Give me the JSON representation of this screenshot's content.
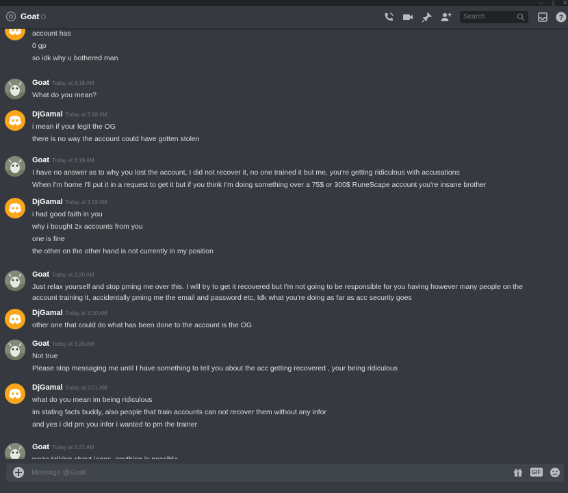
{
  "header": {
    "channel_name": "Goat",
    "search_placeholder": "Search"
  },
  "messages": [
    {
      "author": "DjGamal",
      "avatar": "discord-avatar",
      "time": "",
      "lines": [
        "account has",
        "0 gp",
        "so idk why u bothered man"
      ]
    },
    {
      "author": "Goat",
      "avatar": "goat-avatar",
      "time": "Today at 3:18 AM",
      "lines": [
        "What do you mean?"
      ]
    },
    {
      "author": "DjGamal",
      "avatar": "discord-avatar",
      "time": "Today at 3:18 AM",
      "lines": [
        "i mean if your legit the OG",
        "there is no way the account could have gotten stolen"
      ]
    },
    {
      "author": "Goat",
      "avatar": "goat-avatar",
      "time": "Today at 3:19 AM",
      "lines": [
        "I have no answer as to why you lost the account, I did not recover it, no one trained it but me, you're getting ridiculous with accusations",
        "When I'm home I'll put it in a request to get it but if you think I'm doing something over a 75$ or 300$ RuneScape account you're insane brother"
      ]
    },
    {
      "author": "DjGamal",
      "avatar": "discord-avatar",
      "time": "Today at 3:19 AM",
      "lines": [
        "i had good faith in you",
        "why i bought 2x accounts from you",
        "one is fine",
        "the other on the other hand is not currently in my position"
      ]
    },
    {
      "author": "Goat",
      "avatar": "goat-avatar",
      "time": "Today at 3:20 AM",
      "lines": [
        "Just relax yourself and stop pming me over this. I will try to get it recovered but I'm not going to be responsible for you having however many people on the",
        "account training it, accidentally pming me the email and password etc, Idk what you're doing as far as acc security goes"
      ]
    },
    {
      "author": "DjGamal",
      "avatar": "discord-avatar",
      "time": "Today at 3:20 AM",
      "lines": [
        "other one that could do what has been done to the account is the OG"
      ]
    },
    {
      "author": "Goat",
      "avatar": "goat-avatar",
      "time": "Today at 3:20 AM",
      "lines": [
        "Not true",
        "Please stop messaging me until I have something to tell you about the acc getting recovered , your being ridiculous"
      ]
    },
    {
      "author": "DjGamal",
      "avatar": "discord-avatar",
      "time": "Today at 3:21 AM",
      "lines": [
        "what do you mean im being ridiculous",
        "im stating facts buddy, also people that train accounts can not recover them without any infor",
        "and yes i did pm you infor i wanted to pm the trainer"
      ]
    },
    {
      "author": "Goat",
      "avatar": "goat-avatar",
      "time": "Today at 3:22 AM",
      "lines": [
        "we're talking about jagex, anything is possible"
      ]
    }
  ],
  "composer": {
    "placeholder": "Message @Goat",
    "gif_label": "GIF"
  }
}
